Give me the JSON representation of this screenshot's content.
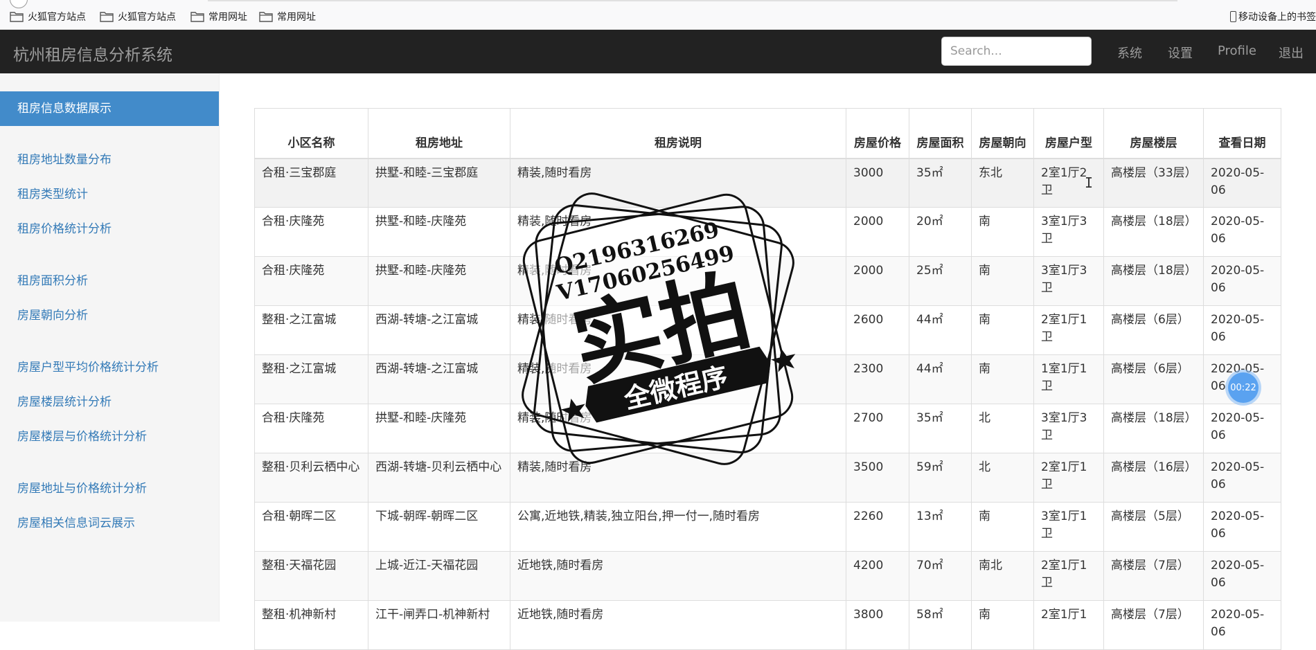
{
  "bookmarks": {
    "items": [
      {
        "label": "火狐官方站点",
        "icon": "folder-icon"
      },
      {
        "label": "火狐官方站点",
        "icon": "folder-icon"
      },
      {
        "label": "常用网址",
        "icon": "folder-icon"
      },
      {
        "label": "常用网址",
        "icon": "folder-icon"
      }
    ],
    "mobile_label": "移动设备上的书签"
  },
  "navbar": {
    "brand": "杭州租房信息分析系统",
    "search_placeholder": "Search...",
    "links": [
      "系统",
      "设置",
      "Profile",
      "退出"
    ],
    "background": "#222222"
  },
  "sidebar": {
    "items": [
      {
        "label": "租房信息数据展示",
        "active": true
      },
      {
        "label": "租房地址数量分布"
      },
      {
        "label": "租房类型统计"
      },
      {
        "label": "租房价格统计分析"
      },
      {
        "label": "租房面积分析"
      },
      {
        "label": "房屋朝向分析"
      },
      {
        "label": "房屋户型平均价格统计分析"
      },
      {
        "label": "房屋楼层统计分析"
      },
      {
        "label": "房屋楼层与价格统计分析"
      },
      {
        "label": "房屋地址与价格统计分析"
      },
      {
        "label": "房屋相关信息词云展示"
      }
    ],
    "active_color": "#428bca",
    "link_color": "#337ab7"
  },
  "table": {
    "headers": [
      "小区名称",
      "租房地址",
      "租房说明",
      "房屋价格",
      "房屋面积",
      "房屋朝向",
      "房屋户型",
      "房屋楼层",
      "查看日期"
    ],
    "rows": [
      [
        "合租·三宝郡庭",
        "拱墅-和睦-三宝郡庭",
        "精装,随时看房",
        "3000",
        "35㎡",
        "东北",
        "2室1厅2卫",
        "高楼层（33层）",
        "2020-05-06"
      ],
      [
        "合租·庆隆苑",
        "拱墅-和睦-庆隆苑",
        "精装,随时看房",
        "2000",
        "20㎡",
        "南",
        "3室1厅3卫",
        "高楼层（18层）",
        "2020-05-06"
      ],
      [
        "合租·庆隆苑",
        "拱墅-和睦-庆隆苑",
        "精装,随时看房",
        "2000",
        "25㎡",
        "南",
        "3室1厅3卫",
        "高楼层（18层）",
        "2020-05-06"
      ],
      [
        "整租·之江富城",
        "西湖-转塘-之江富城",
        "精装,随时看房",
        "2600",
        "44㎡",
        "南",
        "2室1厅1卫",
        "高楼层（6层）",
        "2020-05-06"
      ],
      [
        "整租·之江富城",
        "西湖-转塘-之江富城",
        "精装,随时看房",
        "2300",
        "44㎡",
        "南",
        "1室1厅1卫",
        "高楼层（6层）",
        "2020-05-06"
      ],
      [
        "合租·庆隆苑",
        "拱墅-和睦-庆隆苑",
        "精装,随时看房",
        "2700",
        "35㎡",
        "北",
        "3室1厅3卫",
        "高楼层（18层）",
        "2020-05-06"
      ],
      [
        "整租·贝利云栖中心",
        "西湖-转塘-贝利云栖中心",
        "精装,随时看房",
        "3500",
        "59㎡",
        "北",
        "2室1厅1卫",
        "高楼层（16层）",
        "2020-05-06"
      ],
      [
        "合租·朝晖二区",
        "下城-朝晖-朝晖二区",
        "公寓,近地铁,精装,独立阳台,押一付一,随时看房",
        "2260",
        "13㎡",
        "南",
        "3室1厅1卫",
        "高楼层（5层）",
        "2020-05-06"
      ],
      [
        "整租·天福花园",
        "上城-近江-天福花园",
        "近地铁,随时看房",
        "4200",
        "70㎡",
        "南北",
        "2室1厅1卫",
        "高楼层（7层）",
        "2020-05-06"
      ],
      [
        "整租·机神新村",
        "江干-闸弄口-机神新村",
        "近地铁,随时看房",
        "3800",
        "58㎡",
        "南",
        "2室1厅1",
        "高楼层（7层）",
        "2020-05-06"
      ]
    ]
  },
  "watermark": {
    "line1": "Q2196316269",
    "line2": "V17060256499",
    "main": "实拍",
    "banner": "全微程序"
  },
  "timer": "00:22"
}
